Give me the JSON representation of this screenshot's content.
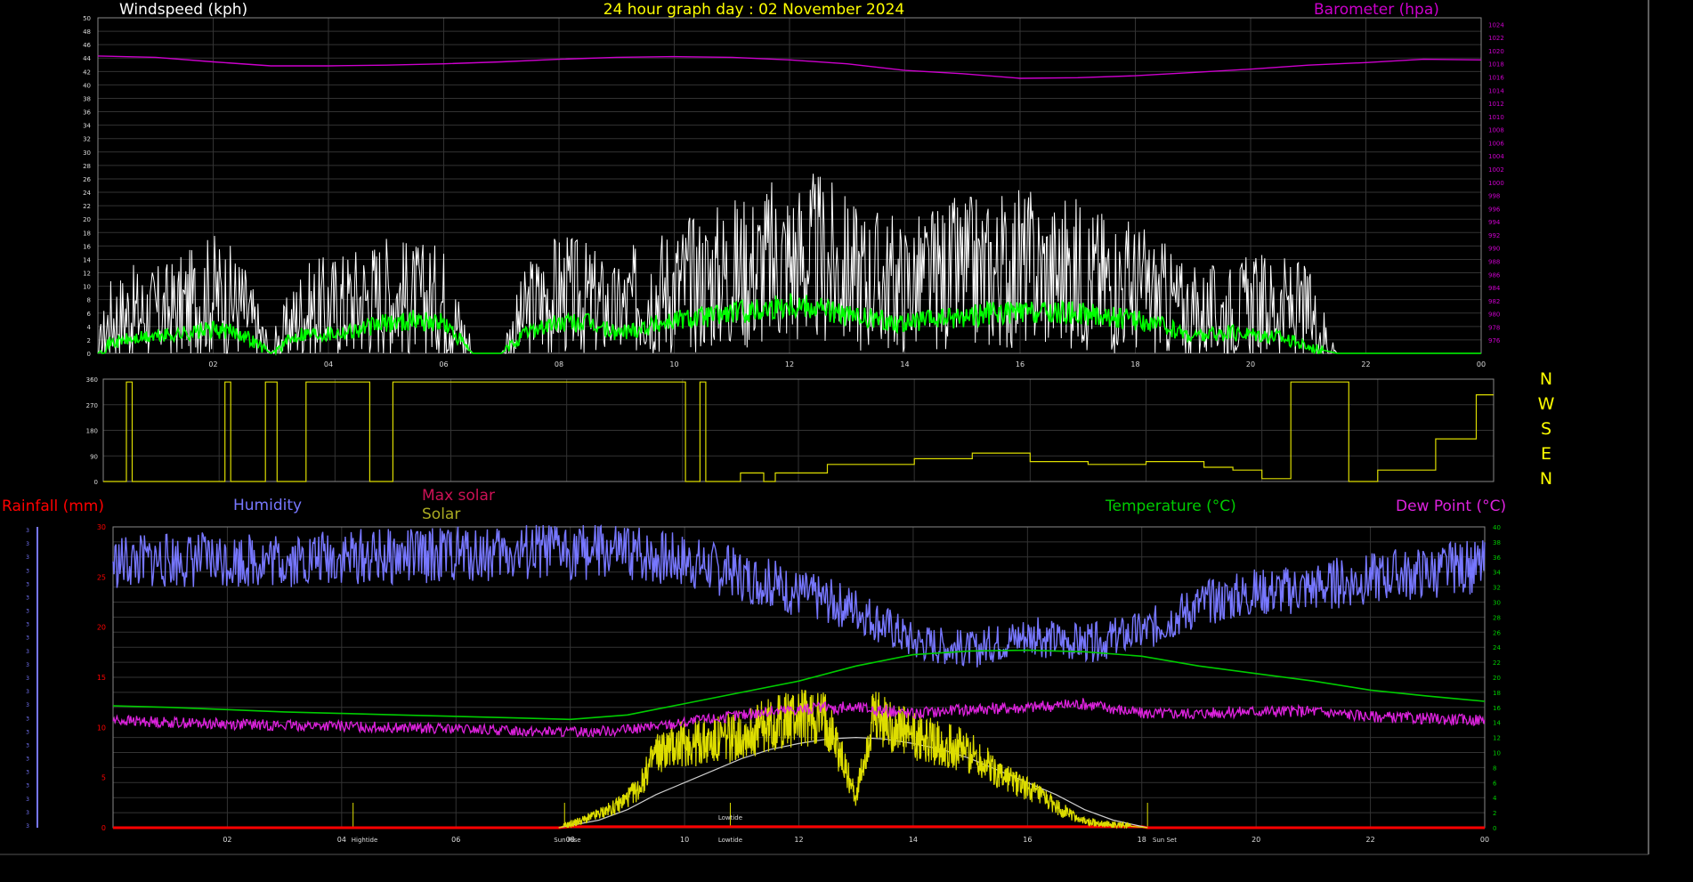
{
  "colors": {
    "wind": "#ffffff",
    "wind_avg": "#00ff00",
    "barometer": "#cc00cc",
    "direction": "#dddd00",
    "rain": "#ff0000",
    "humidity": "#7777ff",
    "max_solar": "#cccccc",
    "solar": "#dddd00",
    "temperature": "#00cc00",
    "dew_point": "#dd22dd",
    "title": "#ffff00",
    "grid": "#333333",
    "axis_frame": "#888888"
  },
  "header": {
    "title": "24 hour graph day : 02 November 2024",
    "windspeed_label": "Windspeed (kph)",
    "barometer_label": "Barometer (hpa)"
  },
  "compass": [
    "N",
    "W",
    "S",
    "E",
    "N"
  ],
  "bottom_labels": {
    "rainfall": "Rainfall (mm)",
    "humidity": "Humidity",
    "max_solar": "Max solar",
    "solar": "Solar",
    "temperature": "Temperature (°C)",
    "dew_point": "Dew Point (°C)"
  },
  "chart_data": [
    {
      "type": "line",
      "title": "24 hour graph day : 02 November 2024",
      "x_ticks": [
        "02",
        "04",
        "06",
        "08",
        "10",
        "12",
        "14",
        "16",
        "18",
        "20",
        "22",
        "00"
      ],
      "xlim_hours": [
        0,
        24
      ],
      "grid": true,
      "left_axis": {
        "label": "Windspeed (kph)",
        "ylim": [
          0,
          50
        ],
        "ticks": [
          0,
          2,
          4,
          6,
          8,
          10,
          12,
          14,
          16,
          18,
          20,
          22,
          24,
          26,
          28,
          30,
          32,
          34,
          36,
          38,
          40,
          42,
          44,
          46,
          48,
          50
        ]
      },
      "right_axis": {
        "label": "Barometer (hpa)",
        "ylim": [
          974,
          1025
        ],
        "ticks": [
          976,
          978,
          980,
          982,
          984,
          986,
          988,
          990,
          992,
          994,
          996,
          998,
          1000,
          1002,
          1004,
          1006,
          1008,
          1010,
          1012,
          1014,
          1016,
          1018,
          1020,
          1022,
          1024
        ]
      },
      "series": [
        {
          "name": "Windspeed (kph)",
          "axis": "left",
          "style": "gust",
          "x": [
            0,
            0.2,
            0.5,
            1,
            1.5,
            2,
            2.5,
            3,
            3.5,
            4,
            4.5,
            5,
            5.5,
            6,
            6.5,
            7,
            7.5,
            8,
            8.5,
            9,
            9.5,
            10,
            10.5,
            11,
            11.5,
            12,
            12.5,
            13,
            13.5,
            14,
            14.5,
            15,
            15.5,
            16,
            16.5,
            17,
            17.5,
            18,
            18.5,
            19,
            19.5,
            20,
            20.5,
            21,
            21.5,
            22,
            23,
            24
          ],
          "y": [
            0,
            5,
            6,
            6,
            7,
            9,
            7,
            0,
            6,
            7,
            8,
            9,
            8,
            8,
            0,
            0,
            7,
            9,
            8,
            6,
            9,
            10,
            11,
            12,
            13,
            14,
            14,
            12,
            11,
            10,
            11,
            12,
            12,
            13,
            12,
            12,
            11,
            10,
            8,
            6,
            6,
            7,
            7,
            6,
            0,
            0,
            0,
            0
          ]
        },
        {
          "name": "Windspeed average",
          "axis": "left",
          "style": "avg",
          "x": [
            0,
            0.2,
            0.5,
            1,
            1.5,
            2,
            2.5,
            3,
            3.5,
            4,
            4.5,
            5,
            5.5,
            6,
            6.5,
            7,
            7.5,
            8,
            8.5,
            9,
            9.5,
            10,
            10.5,
            11,
            11.5,
            12,
            12.5,
            13,
            13.5,
            14,
            14.5,
            15,
            15.5,
            16,
            16.5,
            17,
            17.5,
            18,
            18.5,
            19,
            19.5,
            20,
            20.5,
            21,
            21.5,
            22,
            23,
            24
          ],
          "y": [
            0,
            1.5,
            2,
            2.5,
            3,
            3.5,
            3,
            0,
            3,
            3,
            3.5,
            4.5,
            5,
            4.5,
            0,
            0,
            3.5,
            4.5,
            4.5,
            3,
            4,
            5,
            5.5,
            6,
            6.5,
            7.5,
            7,
            5.5,
            5,
            4.5,
            5,
            5.5,
            6,
            6,
            6,
            6,
            5.5,
            5,
            4,
            2.5,
            3,
            3,
            2.5,
            1,
            0,
            0,
            0,
            0
          ]
        },
        {
          "name": "Barometer (hpa)",
          "axis": "right",
          "x": [
            0,
            1,
            2,
            3,
            4,
            5,
            6,
            7,
            8,
            9,
            10,
            11,
            12,
            13,
            14,
            15,
            16,
            17,
            18,
            19,
            20,
            21,
            22,
            23,
            24
          ],
          "y": [
            1019.2,
            1019.0,
            1018.3,
            1017.7,
            1017.7,
            1017.8,
            1018.0,
            1018.3,
            1018.7,
            1019.0,
            1019.1,
            1019.0,
            1018.6,
            1018.0,
            1017.0,
            1016.5,
            1015.8,
            1015.9,
            1016.2,
            1016.7,
            1017.2,
            1017.8,
            1018.2,
            1018.7,
            1018.6
          ]
        }
      ]
    },
    {
      "type": "line",
      "title": "",
      "xlim_hours": [
        0,
        24
      ],
      "grid": true,
      "ylim": [
        0,
        360
      ],
      "y_ticks": [
        0,
        90,
        180,
        270,
        360
      ],
      "series": [
        {
          "name": "Wind direction",
          "style": "step",
          "x": [
            0,
            0.4,
            0.5,
            2.1,
            2.2,
            2.8,
            3.0,
            3.5,
            4.6,
            5.0,
            5.5,
            6.5,
            10.0,
            10.05,
            10.3,
            10.4,
            11.0,
            11.4,
            11.6,
            12.5,
            14.0,
            15.0,
            16.0,
            17.0,
            18.0,
            19.0,
            19.5,
            20.0,
            20.5,
            21.0,
            21.5,
            22.0,
            23.0,
            23.6,
            23.7,
            24.0
          ],
          "y": [
            0,
            350,
            0,
            350,
            0,
            350,
            0,
            350,
            0,
            350,
            350,
            350,
            350,
            0,
            350,
            0,
            30,
            0,
            30,
            60,
            80,
            100,
            70,
            60,
            70,
            50,
            40,
            10,
            350,
            350,
            0,
            40,
            150,
            150,
            305,
            305
          ]
        }
      ]
    },
    {
      "type": "line",
      "title": "",
      "x_ticks": [
        "02",
        "04",
        "06",
        "08",
        "10",
        "12",
        "14",
        "16",
        "18",
        "20",
        "22",
        "00"
      ],
      "xlim_hours": [
        0,
        24
      ],
      "grid": true,
      "rain_axis": {
        "label": "Rainfall (mm)",
        "ylim": [
          0,
          30
        ],
        "ticks": [
          0,
          5,
          10,
          15,
          20,
          25,
          30
        ]
      },
      "percent_axis": {
        "ylim": [
          0,
          100
        ]
      },
      "temp_axis": {
        "label": "Temperature (°C)",
        "ylim": [
          0,
          40
        ],
        "ticks": [
          0,
          2,
          4,
          6,
          8,
          10,
          12,
          14,
          16,
          18,
          20,
          22,
          24,
          26,
          28,
          30,
          32,
          34,
          36,
          38,
          40
        ]
      },
      "markers": [
        {
          "label": "Hightide",
          "hour": 4.2
        },
        {
          "label": "Sun Rise",
          "hour": 7.9
        },
        {
          "label": "Lowtide",
          "hour": 10.8
        },
        {
          "label": "Sun Set",
          "hour": 18.1
        }
      ],
      "annotation_labels": [
        "Hightide",
        "Sun Rise",
        "Lowtide",
        "Lowtide",
        "Sun Set"
      ],
      "series": [
        {
          "name": "Rainfall (mm)",
          "axis": "rain",
          "x": [
            0,
            7.8,
            8,
            18,
            18.1,
            24
          ],
          "y": [
            0,
            0,
            0.1,
            0.1,
            0,
            0
          ]
        },
        {
          "name": "Humidity",
          "axis": "percent",
          "x": [
            0,
            1,
            2,
            3,
            4,
            5,
            6,
            7,
            8,
            9,
            10,
            11,
            12,
            13,
            14,
            15,
            16,
            17,
            18,
            19,
            20,
            21,
            22,
            23,
            24
          ],
          "y": [
            88,
            89,
            89,
            89,
            90,
            90,
            91,
            91,
            92,
            91,
            89,
            84,
            78,
            73,
            62,
            59,
            64,
            61,
            65,
            74,
            78,
            80,
            83,
            85,
            87
          ]
        },
        {
          "name": "Max solar",
          "axis": "percent",
          "x": [
            7.8,
            8.5,
            9,
            9.5,
            10,
            10.5,
            11,
            11.5,
            12,
            12.5,
            13,
            13.5,
            14,
            14.5,
            15,
            15.5,
            16,
            16.5,
            17,
            17.5,
            18.1
          ],
          "y": [
            0,
            2.5,
            6,
            11,
            15,
            19,
            23,
            26,
            28,
            29.5,
            30,
            29.5,
            28,
            26,
            23,
            19,
            15,
            11,
            6,
            2.5,
            0
          ]
        },
        {
          "name": "Solar",
          "axis": "percent",
          "x": [
            7.8,
            8.3,
            8.8,
            9.2,
            9.5,
            10,
            10.5,
            11,
            11.5,
            12,
            12.5,
            13,
            13.3,
            13.6,
            14,
            14.5,
            15,
            15.5,
            16,
            16.5,
            17,
            17.5,
            18.1
          ],
          "y": [
            0,
            3,
            7,
            13,
            25,
            28,
            28.5,
            31,
            34,
            37,
            36,
            10,
            36,
            34,
            30,
            28,
            25,
            18,
            13,
            7,
            2,
            1,
            0
          ]
        },
        {
          "name": "Temperature (°C)",
          "axis": "temp",
          "x": [
            0,
            1,
            2,
            3,
            4,
            5,
            6,
            7,
            8,
            9,
            10,
            11,
            12,
            13,
            14,
            15,
            16,
            17,
            18,
            19,
            20,
            21,
            22,
            23,
            24
          ],
          "y": [
            16.2,
            16,
            15.7,
            15.4,
            15.2,
            15,
            14.8,
            14.6,
            14.4,
            15,
            16.5,
            18,
            19.5,
            21.5,
            23,
            23.5,
            23.6,
            23.4,
            22.8,
            21.5,
            20.5,
            19.5,
            18.3,
            17.5,
            16.8
          ]
        },
        {
          "name": "Dew Point (°C)",
          "axis": "temp",
          "x": [
            0,
            1,
            2,
            3,
            4,
            5,
            6,
            7,
            8,
            9,
            10,
            11,
            12,
            13,
            14,
            15,
            16,
            17,
            18,
            19,
            20,
            21,
            22,
            23,
            24
          ],
          "y": [
            14.3,
            14,
            13.8,
            13.6,
            13.5,
            13.3,
            13.1,
            12.9,
            12.7,
            13,
            14,
            15,
            15.8,
            16,
            15.2,
            15.8,
            16,
            16.5,
            15.2,
            15.2,
            15.5,
            15.5,
            14.8,
            14.5,
            14.3
          ]
        }
      ]
    }
  ]
}
